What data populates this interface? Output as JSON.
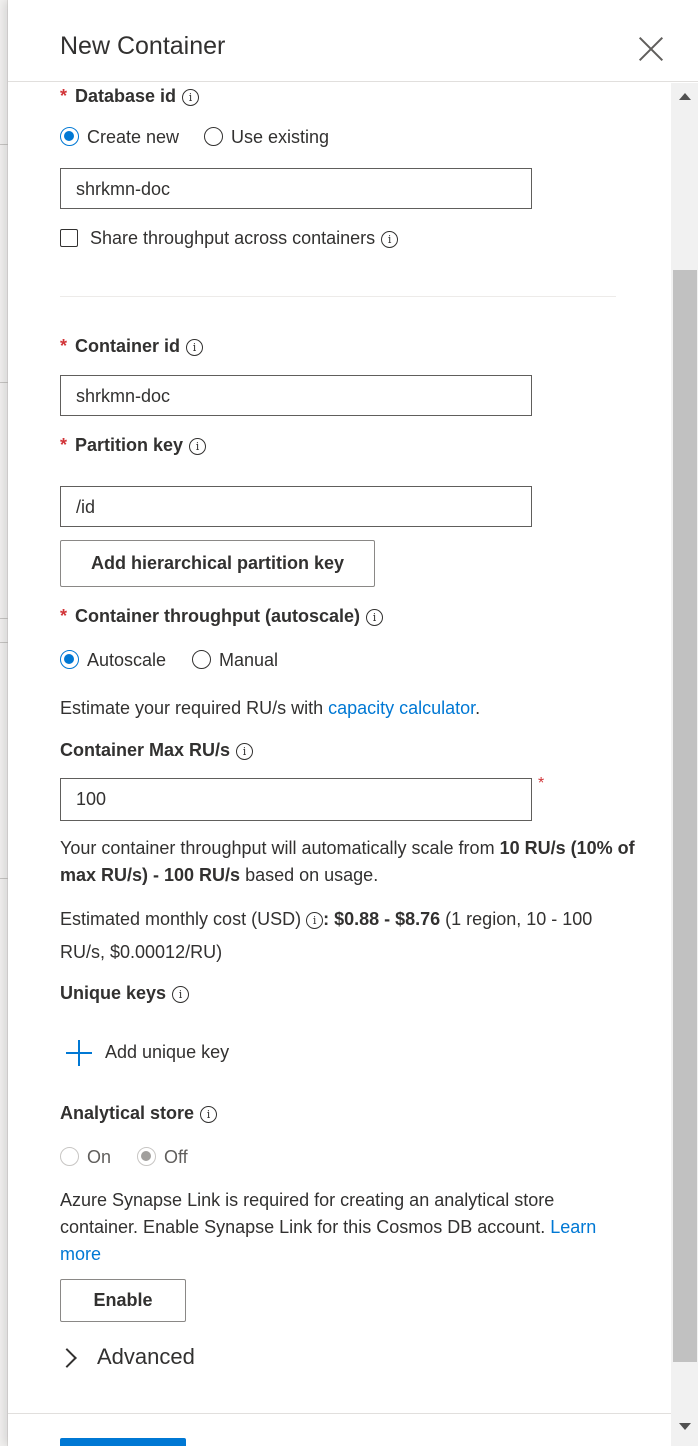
{
  "panel": {
    "title": "New Container"
  },
  "database": {
    "label": "Database id",
    "required_mark": "*",
    "info": "i",
    "options": [
      "Create new",
      "Use existing"
    ],
    "selected": "Create new",
    "value": "shrkmn-doc",
    "share_throughput_label": "Share throughput across containers"
  },
  "container": {
    "label": "Container id",
    "required_mark": "*",
    "info": "i",
    "value": "shrkmn-doc"
  },
  "partition": {
    "label": "Partition key",
    "required_mark": "*",
    "info": "i",
    "value": "/id",
    "add_button": "Add hierarchical partition key"
  },
  "throughput": {
    "label": "Container throughput (autoscale)",
    "required_mark": "*",
    "info": "i",
    "options": [
      "Autoscale",
      "Manual"
    ],
    "selected": "Autoscale",
    "estimate_prefix": "Estimate your required RU/s with ",
    "estimate_link": "capacity calculator",
    "estimate_suffix": "."
  },
  "max_rus": {
    "label": "Container Max RU/s",
    "info": "i",
    "value": "100",
    "required_mark": "*",
    "scale_prefix": "Your container throughput will automatically scale from ",
    "scale_bold": "10 RU/s (10% of max RU/s) - 100 RU/s",
    "scale_suffix": " based on usage.",
    "cost_prefix": "Estimated monthly cost (USD) ",
    "cost_bold": ": $0.88 - $8.76",
    "cost_suffix": " (1 region, 10 - 100 RU/s, $0.00012/RU)"
  },
  "unique_keys": {
    "label": "Unique keys",
    "info": "i",
    "add_label": "Add unique key"
  },
  "analytical": {
    "label": "Analytical store",
    "info": "i",
    "options": [
      "On",
      "Off"
    ],
    "selected": "Off",
    "notice": "Azure Synapse Link is required for creating an analytical store container. Enable Synapse Link for this Cosmos DB account. ",
    "learn_more": "Learn more",
    "enable_button": "Enable"
  },
  "advanced": {
    "label": "Advanced"
  },
  "colors": {
    "accent": "#0078d4",
    "required": "#d13438"
  }
}
